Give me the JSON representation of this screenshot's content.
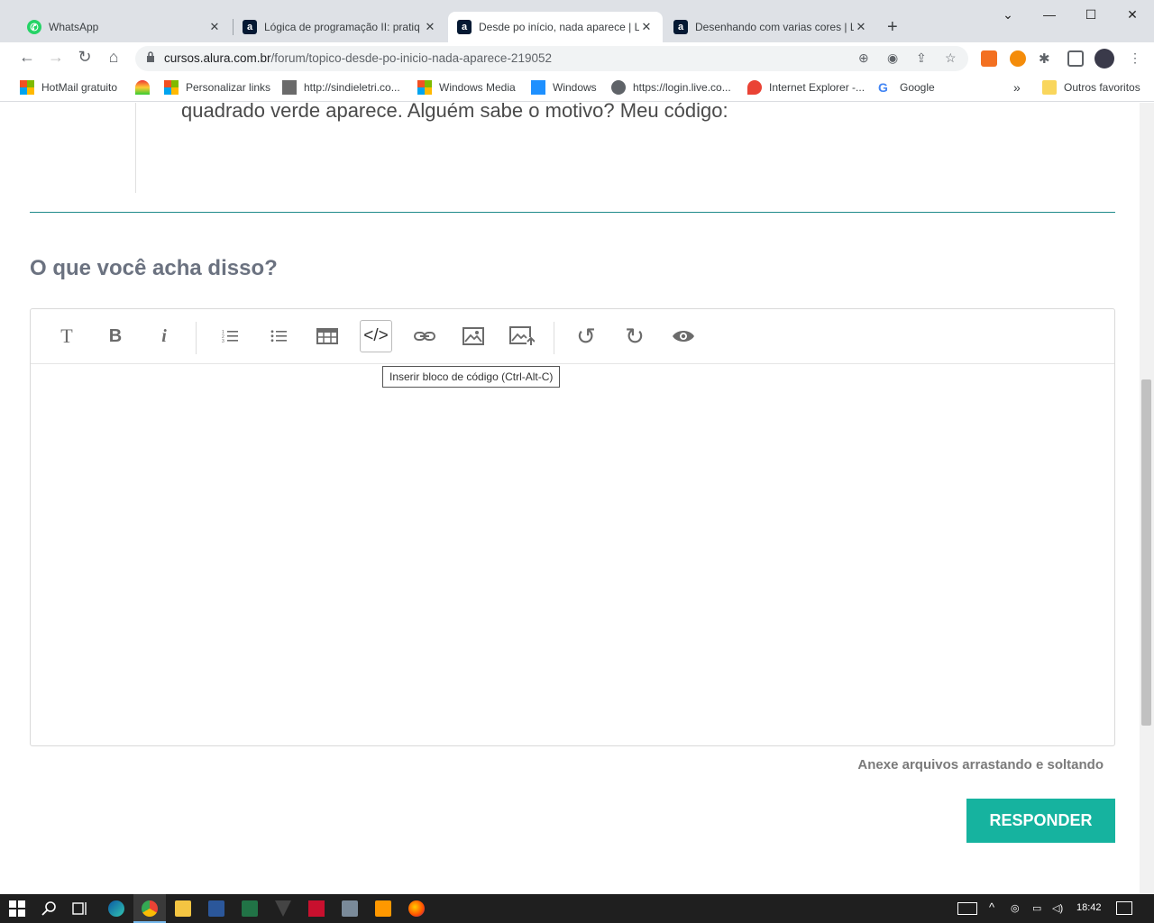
{
  "browser": {
    "tabs": [
      {
        "title": "WhatsApp",
        "icon": "whatsapp-icon",
        "color": "#25d366",
        "active": false
      },
      {
        "title": "Lógica de programação II: pratiq",
        "icon": "alura-icon",
        "color": "#051933",
        "active": false
      },
      {
        "title": "Desde po início, nada aparece | L",
        "icon": "alura-icon",
        "color": "#051933",
        "active": true
      },
      {
        "title": "Desenhando com varias cores | L",
        "icon": "alura-icon",
        "color": "#051933",
        "active": false
      }
    ],
    "url_domain": "cursos.alura.com.br",
    "url_path": "/forum/topico-desde-po-inicio-nada-aparece-219052",
    "bookmarks": [
      {
        "label": "HotMail gratuito",
        "icon": "microsoft-icon"
      },
      {
        "label": "",
        "icon": "rainbow-icon"
      },
      {
        "label": "Personalizar links",
        "icon": "microsoft-icon"
      },
      {
        "label": "http://sindieletri.co...",
        "icon": "page-icon"
      },
      {
        "label": "Windows Media",
        "icon": "microsoft-icon"
      },
      {
        "label": "Windows",
        "icon": "windows-icon"
      },
      {
        "label": "https://login.live.co...",
        "icon": "globe-icon"
      },
      {
        "label": "Internet Explorer -...",
        "icon": "maps-pin-icon"
      },
      {
        "label": "Google",
        "icon": "google-icon"
      }
    ],
    "overflow": "»",
    "other_bookmarks": "Outros favoritos"
  },
  "page": {
    "post_text": "quadrado verde aparece. Alguém sabe o motivo? Meu código:",
    "reply_title": "O que você acha disso?",
    "toolbar_tooltip": "Inserir bloco de código (Ctrl-Alt-C)",
    "attach_hint": "Anexe arquivos arrastando e soltando",
    "reply_button": "RESPONDER",
    "accent_color": "#16b39f"
  },
  "editor_toolbar": [
    {
      "name": "heading",
      "glyph": "T"
    },
    {
      "name": "bold",
      "glyph": "B"
    },
    {
      "name": "italic",
      "glyph": "i"
    },
    {
      "name": "ordered-list",
      "glyph": ""
    },
    {
      "name": "unordered-list",
      "glyph": ""
    },
    {
      "name": "table",
      "glyph": ""
    },
    {
      "name": "code-block",
      "glyph": "</>"
    },
    {
      "name": "link",
      "glyph": ""
    },
    {
      "name": "image",
      "glyph": ""
    },
    {
      "name": "upload-image",
      "glyph": ""
    },
    {
      "name": "undo",
      "glyph": "↺"
    },
    {
      "name": "redo",
      "glyph": "↻"
    },
    {
      "name": "preview",
      "glyph": ""
    }
  ],
  "taskbar": {
    "clock": "18:42"
  }
}
